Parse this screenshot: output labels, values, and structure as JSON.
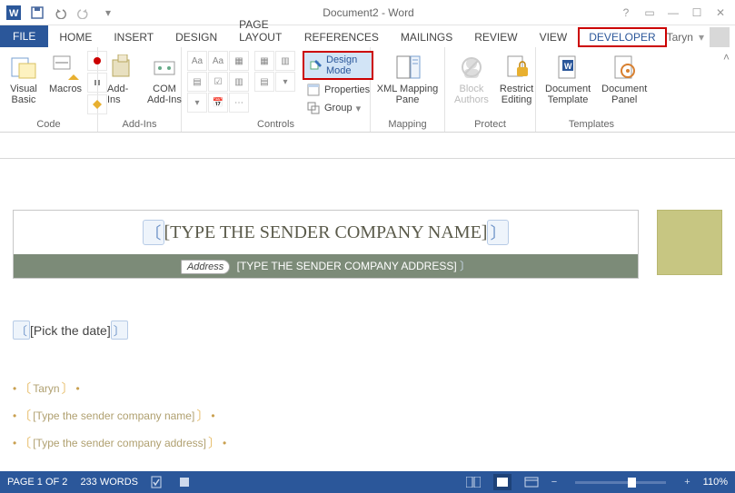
{
  "app": {
    "title": "Document2 - Word"
  },
  "qat": {
    "save": "save-icon",
    "undo": "undo-icon",
    "redo": "redo-icon"
  },
  "tabs": {
    "file": "FILE",
    "items": [
      "HOME",
      "INSERT",
      "DESIGN",
      "PAGE LAYOUT",
      "REFERENCES",
      "MAILINGS",
      "REVIEW",
      "VIEW"
    ],
    "developer": "DEVELOPER",
    "user": "Taryn"
  },
  "ribbon": {
    "code": {
      "visual_basic": "Visual\nBasic",
      "macros": "Macros",
      "label": "Code"
    },
    "addins": {
      "addins": "Add-Ins",
      "com": "COM\nAdd-Ins",
      "label": "Add-Ins"
    },
    "controls": {
      "design_mode": "Design Mode",
      "properties": "Properties",
      "group": "Group",
      "label": "Controls"
    },
    "mapping": {
      "xml_pane": "XML Mapping\nPane",
      "label": "Mapping"
    },
    "protect": {
      "block": "Block\nAuthors",
      "restrict": "Restrict\nEditing",
      "label": "Protect"
    },
    "templates": {
      "doc_template": "Document\nTemplate",
      "doc_panel": "Document\nPanel",
      "label": "Templates"
    }
  },
  "document": {
    "sender_company_title": "[TYPE THE SENDER COMPANY NAME]",
    "address_label": "Address",
    "sender_address": "[TYPE THE SENDER COMPANY ADDRESS]",
    "date": "[Pick the date]",
    "fields": {
      "name": "Taryn",
      "company": "[Type the sender company name]",
      "address": "[Type the sender company address]"
    }
  },
  "status": {
    "page": "PAGE 1 OF 2",
    "words": "233 WORDS",
    "zoom": "110%"
  }
}
